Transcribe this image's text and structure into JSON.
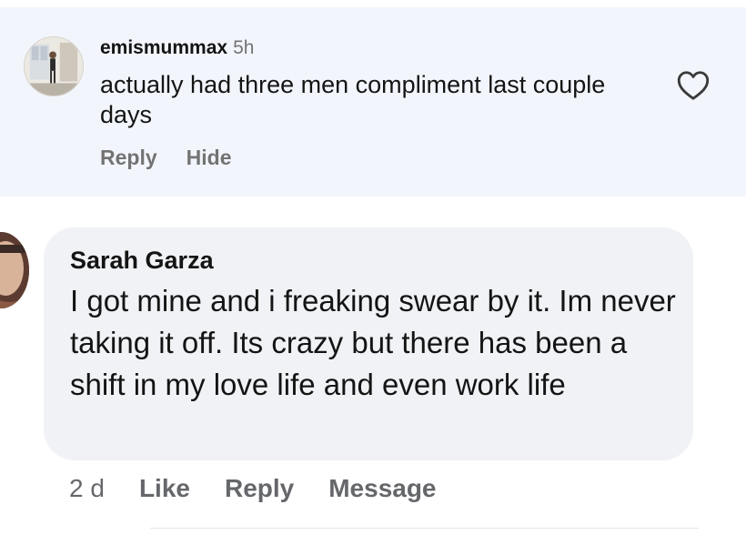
{
  "top_comment": {
    "username": "emismummax",
    "time": "5h",
    "text": "actually had three men compliment last couple days",
    "actions": {
      "reply": "Reply",
      "hide": "Hide"
    },
    "like_icon": "heart-outline-icon"
  },
  "second_comment": {
    "author": "Sarah Garza",
    "text": "I got mine and i freaking swear by it. Im never taking it off. Its crazy but there has been a shift in my love life and even work life",
    "age": "2 d",
    "actions": {
      "like": "Like",
      "reply": "Reply",
      "message": "Message"
    }
  },
  "colors": {
    "highlight_bg": "#f2f6fc",
    "bubble_bg": "#f0f2f5",
    "secondary_text": "#737373"
  }
}
